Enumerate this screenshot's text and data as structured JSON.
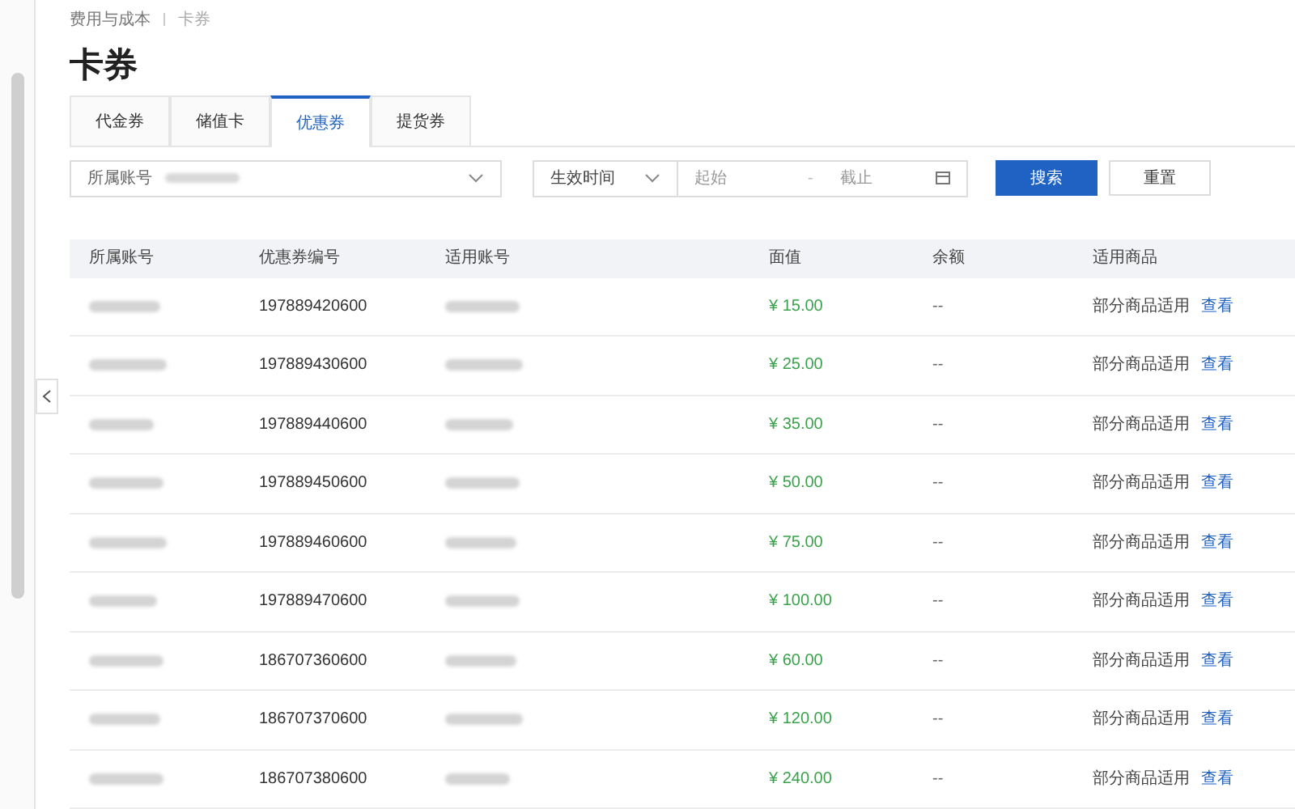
{
  "breadcrumb": [
    "费用与成本",
    "卡券"
  ],
  "title": "卡券",
  "tabs": [
    {
      "label": "代金券",
      "selected": false
    },
    {
      "label": "储值卡",
      "selected": false
    },
    {
      "label": "优惠券",
      "selected": true
    },
    {
      "label": "提货券",
      "selected": false
    }
  ],
  "filters": {
    "account_label": "所属账号",
    "time_type": "生效时间",
    "start_placeholder": "起始",
    "separator": "-",
    "end_placeholder": "截止",
    "search_button": "搜索",
    "reset_button": "重置"
  },
  "table": {
    "columns": [
      "所属账号",
      "优惠券编号",
      "适用账号",
      "面值",
      "余额",
      "适用商品"
    ],
    "rows": [
      {
        "coupon_no": "197889420600",
        "face_value": "¥ 15.00",
        "balance": "--",
        "goods": "部分商品适用",
        "link": "查看"
      },
      {
        "coupon_no": "197889430600",
        "face_value": "¥ 25.00",
        "balance": "--",
        "goods": "部分商品适用",
        "link": "查看"
      },
      {
        "coupon_no": "197889440600",
        "face_value": "¥ 35.00",
        "balance": "--",
        "goods": "部分商品适用",
        "link": "查看"
      },
      {
        "coupon_no": "197889450600",
        "face_value": "¥ 50.00",
        "balance": "--",
        "goods": "部分商品适用",
        "link": "查看"
      },
      {
        "coupon_no": "197889460600",
        "face_value": "¥ 75.00",
        "balance": "--",
        "goods": "部分商品适用",
        "link": "查看"
      },
      {
        "coupon_no": "197889470600",
        "face_value": "¥ 100.00",
        "balance": "--",
        "goods": "部分商品适用",
        "link": "查看"
      },
      {
        "coupon_no": "186707360600",
        "face_value": "¥ 60.00",
        "balance": "--",
        "goods": "部分商品适用",
        "link": "查看"
      },
      {
        "coupon_no": "186707370600",
        "face_value": "¥ 120.00",
        "balance": "--",
        "goods": "部分商品适用",
        "link": "查看"
      },
      {
        "coupon_no": "186707380600",
        "face_value": "¥ 240.00",
        "balance": "--",
        "goods": "部分商品适用",
        "link": "查看"
      }
    ]
  }
}
